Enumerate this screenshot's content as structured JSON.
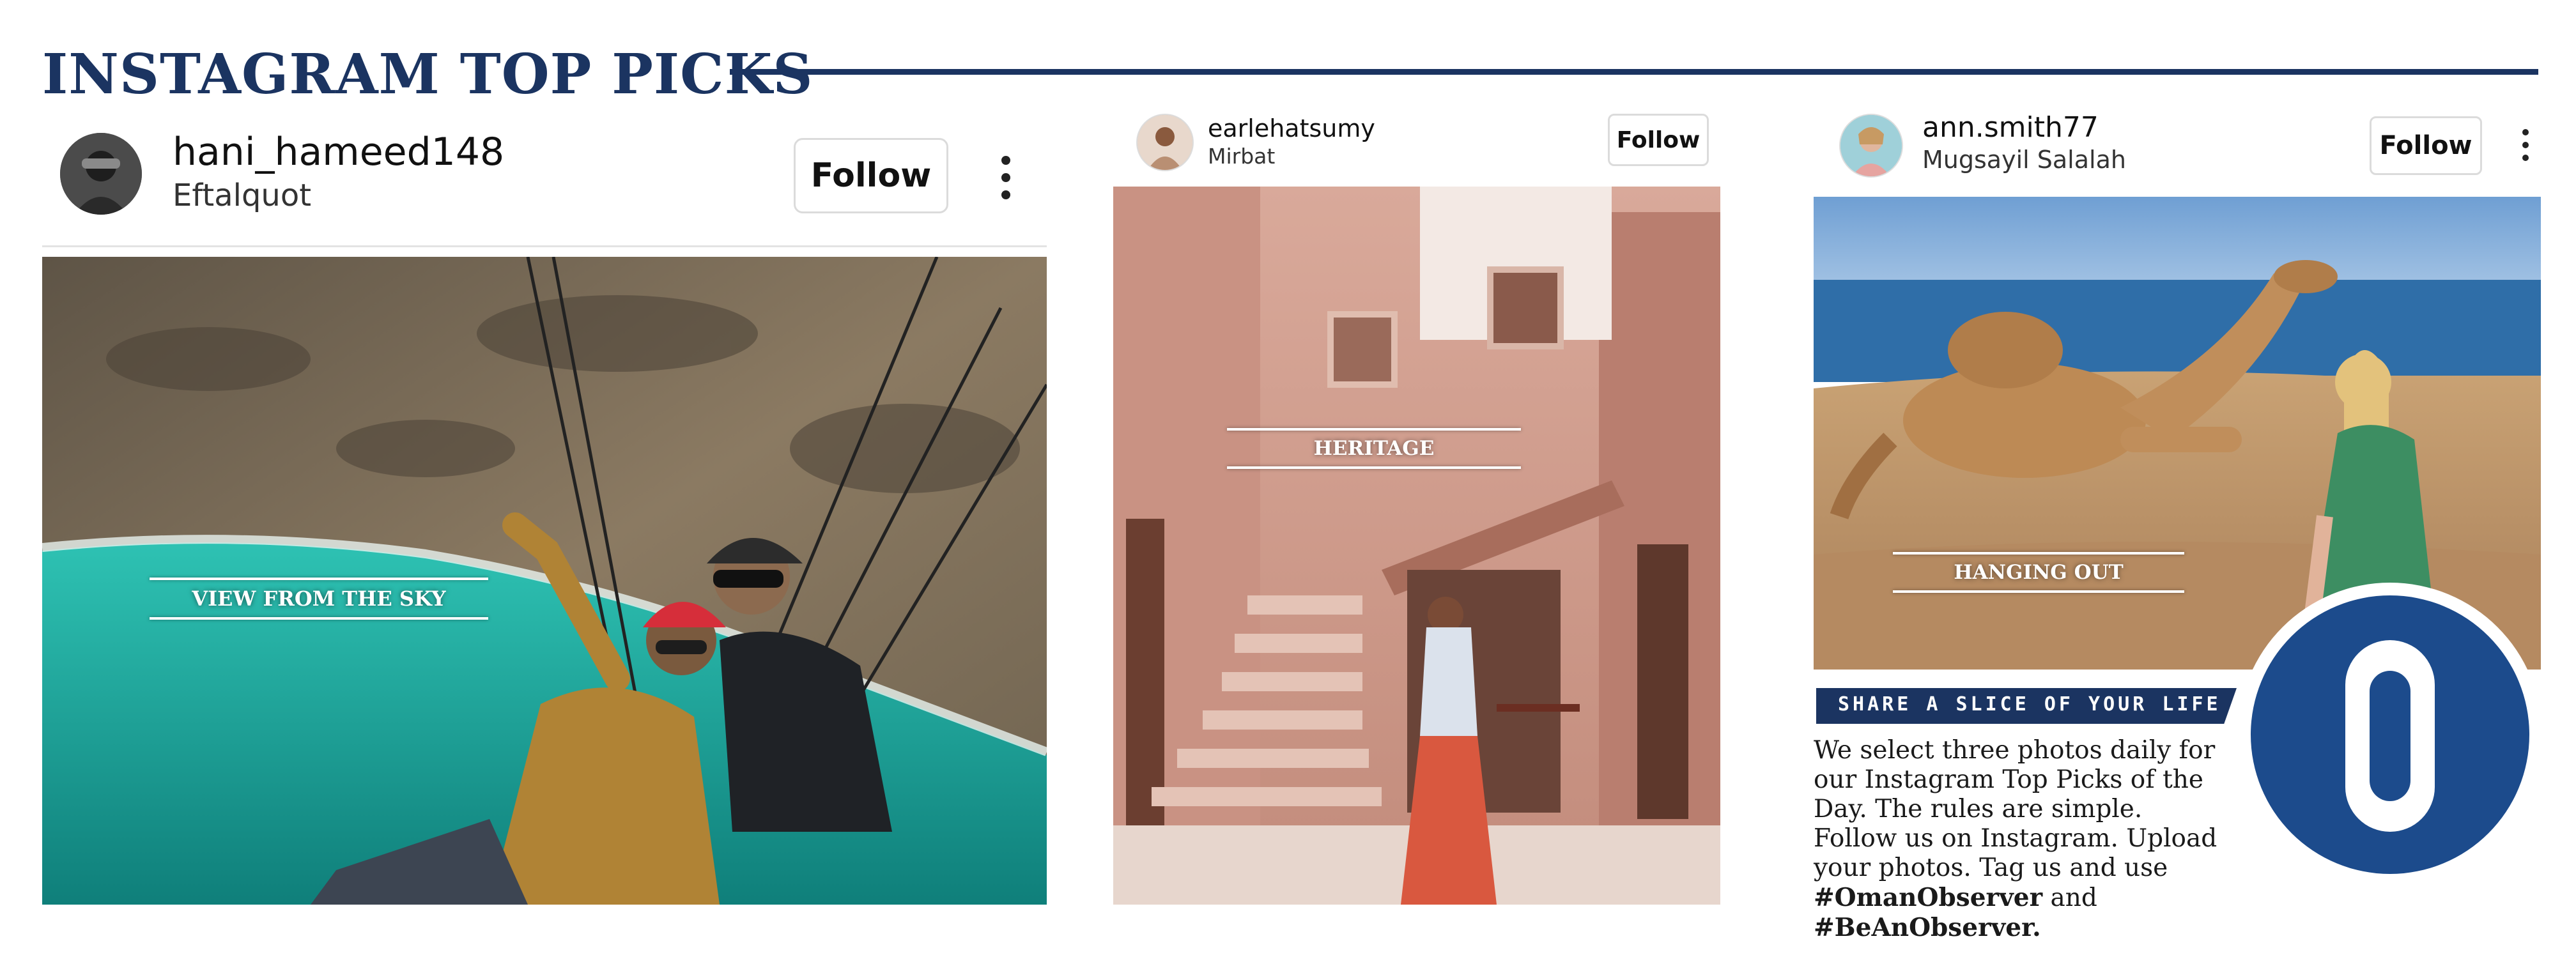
{
  "page": {
    "title": "INSTAGRAM TOP PICKS",
    "accent_color": "#1b3461"
  },
  "posts": [
    {
      "username": "hani_hameed148",
      "location": "Eftalquot",
      "follow_label": "Follow",
      "more_icon": "more-vertical-icon",
      "caption": "VIEW FROM THE SKY"
    },
    {
      "username": "earlehatsumy",
      "location": "Mirbat",
      "follow_label": "Follow",
      "caption": "HERITAGE"
    },
    {
      "username": "ann.smith77",
      "location": "Mugsayil Salalah",
      "follow_label": "Follow",
      "more_icon": "more-vertical-icon",
      "caption": "HANGING OUT"
    }
  ],
  "share": {
    "heading": "SHARE A SLICE OF YOUR LIFE",
    "body": "We select three photos daily for our Instagram Top Picks of the Day. The rules are simple. Follow us on Instagram. Upload your photos. Tag us and use",
    "tag1": "#OmanObserver",
    "joiner": " and ",
    "tag2": "#BeAnObserver."
  },
  "logo": {
    "letter": "O",
    "color": "#1c4b8c"
  }
}
